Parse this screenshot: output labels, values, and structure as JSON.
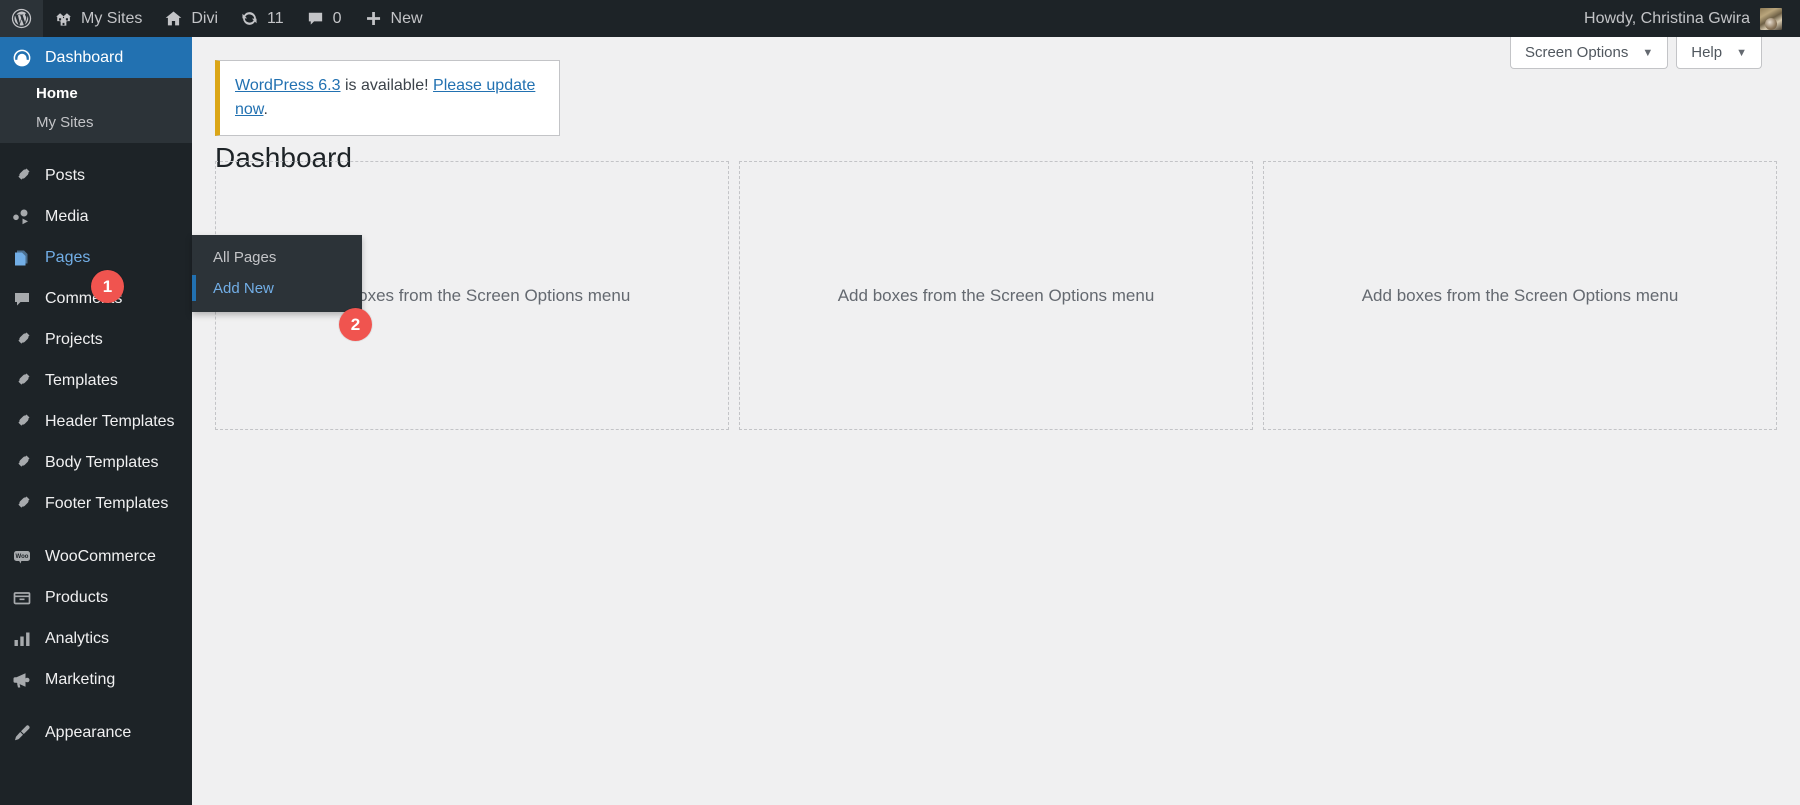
{
  "adminbar": {
    "wp_logo_name": "wordpress-logo-icon",
    "items": [
      {
        "icon": "multisite-icon",
        "label": "My Sites"
      },
      {
        "icon": "home-icon",
        "label": "Divi"
      },
      {
        "icon": "updates-icon",
        "label": "11"
      },
      {
        "icon": "comment-bubble-icon",
        "label": "0"
      },
      {
        "icon": "plus-icon",
        "label": "New"
      }
    ],
    "howdy": "Howdy, Christina Gwira"
  },
  "sidebar": {
    "dashboard": {
      "label": "Dashboard",
      "icon": "dashboard-icon"
    },
    "dashboard_submenu": [
      {
        "label": "Home",
        "current": true
      },
      {
        "label": "My Sites",
        "current": false
      }
    ],
    "items": [
      {
        "label": "Posts",
        "icon": "pin-icon"
      },
      {
        "label": "Media",
        "icon": "media-icon"
      },
      {
        "label": "Pages",
        "icon": "pages-icon",
        "badge": "1",
        "hovered": true
      },
      {
        "label": "Comments",
        "icon": "comment-bubble-icon"
      },
      {
        "label": "Projects",
        "icon": "pin-icon"
      },
      {
        "label": "Templates",
        "icon": "pin-icon"
      },
      {
        "label": "Header Templates",
        "icon": "pin-icon"
      },
      {
        "label": "Body Templates",
        "icon": "pin-icon"
      },
      {
        "label": "Footer Templates",
        "icon": "pin-icon"
      },
      {
        "label": "WooCommerce",
        "icon": "woo-icon"
      },
      {
        "label": "Products",
        "icon": "products-icon"
      },
      {
        "label": "Analytics",
        "icon": "analytics-icon"
      },
      {
        "label": "Marketing",
        "icon": "megaphone-icon"
      },
      {
        "label": "Appearance",
        "icon": "brush-icon"
      }
    ]
  },
  "flyout": {
    "items": [
      {
        "label": "All Pages",
        "current": false
      },
      {
        "label": "Add New",
        "current": true,
        "badge": "2"
      }
    ]
  },
  "screen_meta": {
    "screen_options": "Screen Options",
    "help": "Help",
    "caret": "▼"
  },
  "notice": {
    "link_version": "WordPress 6.3",
    "middle": " is available! ",
    "link_update": "Please update now",
    "period": "."
  },
  "page": {
    "title": "Dashboard",
    "widget_empty_text": "Add boxes from the Screen Options menu",
    "columns": [
      {
        "empty_text": "Add boxes from the Screen Options menu"
      },
      {
        "empty_text": "Add boxes from the Screen Options menu"
      },
      {
        "empty_text": "Add boxes from the Screen Options menu"
      }
    ]
  },
  "colors": {
    "admin_bg": "#1d2327",
    "submenu_bg": "#2c3338",
    "accent_blue": "#2271b1",
    "link_blue": "#72aee6",
    "badge_red": "#f0544f",
    "notice_amber": "#dba617",
    "content_bg": "#f0f0f1"
  }
}
